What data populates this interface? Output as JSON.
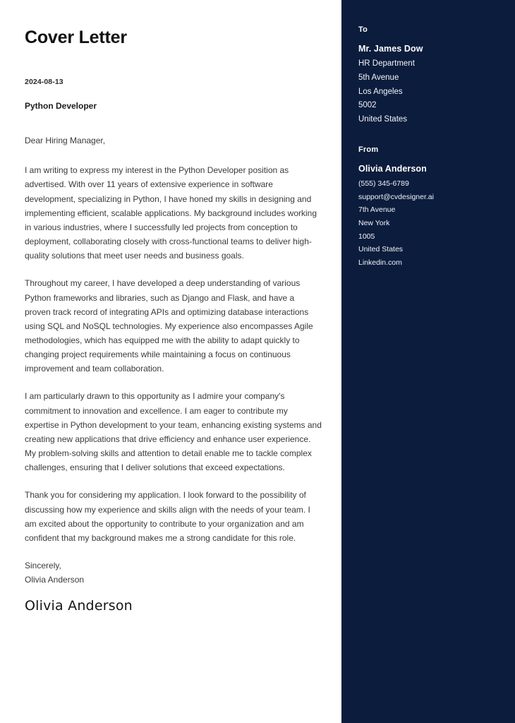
{
  "document": {
    "title": "Cover Letter",
    "date": "2024-08-13",
    "role": "Python Developer",
    "salutation": "Dear Hiring Manager,",
    "paragraphs": [
      "I am writing to express my interest in the Python Developer position as advertised. With over 11 years of extensive experience in software development, specializing in Python, I have honed my skills in designing and implementing efficient, scalable applications. My background includes working in various industries, where I successfully led projects from conception to deployment, collaborating closely with cross-functional teams to deliver high-quality solutions that meet user needs and business goals.",
      "Throughout my career, I have developed a deep understanding of various Python frameworks and libraries, such as Django and Flask, and have a proven track record of integrating APIs and optimizing database interactions using SQL and NoSQL technologies. My experience also encompasses Agile methodologies, which has equipped me with the ability to adapt quickly to changing project requirements while maintaining a focus on continuous improvement and team collaboration.",
      "I am particularly drawn to this opportunity as I admire your company's commitment to innovation and excellence. I am eager to contribute my expertise in Python development to your team, enhancing existing systems and creating new applications that drive efficiency and enhance user experience. My problem-solving skills and attention to detail enable me to tackle complex challenges, ensuring that I deliver solutions that exceed expectations.",
      "Thank you for considering my application. I look forward to the possibility of discussing how my experience and skills align with the needs of your team. I am excited about the opportunity to contribute to your organization and am confident that my background makes me a strong candidate for this role."
    ],
    "closing_word": "Sincerely,",
    "closing_name": "Olivia Anderson",
    "signature": "Olivia Anderson"
  },
  "sidebar": {
    "background_color": "#0b1c3d",
    "to": {
      "label": "To",
      "name": "Mr. James Dow",
      "lines": [
        "HR Department",
        "5th Avenue",
        "Los Angeles",
        "5002",
        "United States"
      ]
    },
    "from": {
      "label": "From",
      "name": "Olivia Anderson",
      "lines": [
        "(555) 345-6789",
        "support@cvdesigner.ai",
        "7th Avenue",
        "New York",
        "1005",
        "United States",
        "Linkedin.com"
      ]
    }
  }
}
